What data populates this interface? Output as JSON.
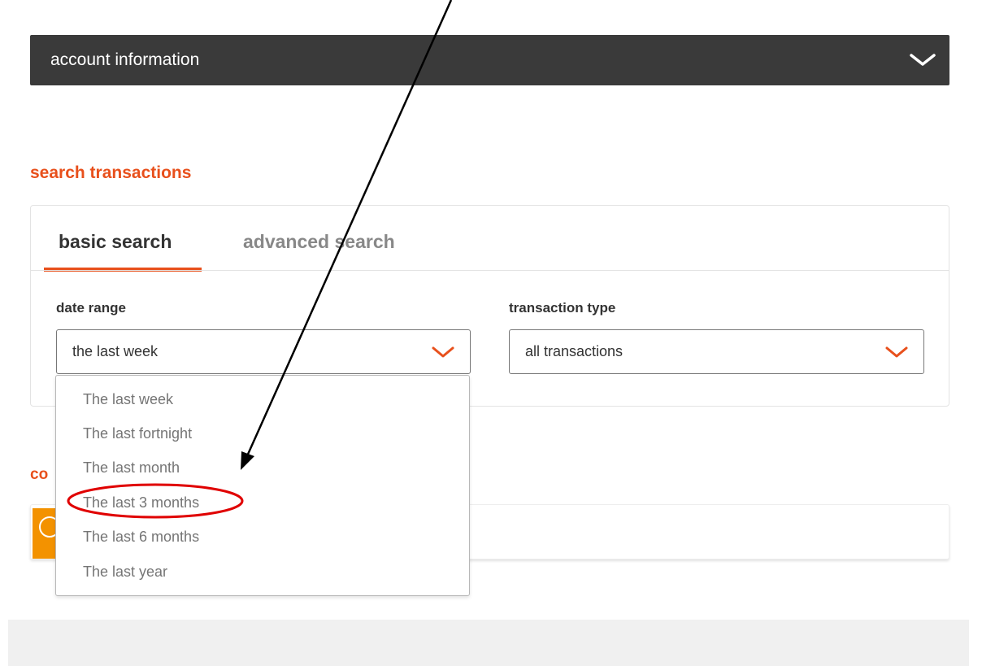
{
  "account": {
    "title": "account information",
    "chevron_icon": "chevron-down-icon"
  },
  "search": {
    "section_title": "search transactions",
    "tabs": [
      {
        "label": "basic search",
        "active": true
      },
      {
        "label": "advanced search",
        "active": false
      }
    ],
    "date_range": {
      "label": "date range",
      "value": "the last week",
      "options": [
        "The last week",
        "The last fortnight",
        "The last month",
        "The last 3 months",
        "The last 6 months",
        "The last year"
      ],
      "highlighted_option": "The last 3 months"
    },
    "transaction_type": {
      "label": "transaction type",
      "value": "all transactions"
    }
  },
  "contact_section": {
    "title_partial": "co"
  },
  "colors": {
    "accent": "#e8501c",
    "header_bg": "#3a3a3a",
    "badge": "#f39200",
    "annotation_circle": "#e00000",
    "annotation_arrow": "#000000"
  }
}
